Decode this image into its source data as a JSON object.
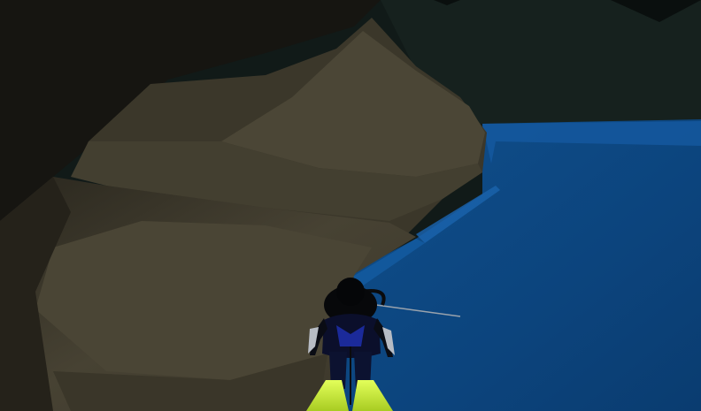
{
  "scene": {
    "environment": "underwater-cave",
    "colors": {
      "cave_shadow": "#0d1513",
      "cave_far_wall": "#1a2623",
      "rock_dark": "#1e1c16",
      "rock_mid": "#3a362a",
      "rock_light": "#4a4535",
      "water_deep": "#0b3f73",
      "water_mid": "#0e4a85",
      "water_edge": "#1a5fa3",
      "diver_body": "#050608",
      "diver_suit_accent": "#1b2a9a",
      "diver_fins": "#c9f03a",
      "diver_gloves": "#b7bcc4",
      "speargun_line": "#9aa3ad"
    },
    "player": {
      "character": "scuba-diver",
      "view": "third-person-behind",
      "equipment": [
        "air-tank",
        "regulator-hose",
        "fins",
        "speargun"
      ]
    }
  }
}
